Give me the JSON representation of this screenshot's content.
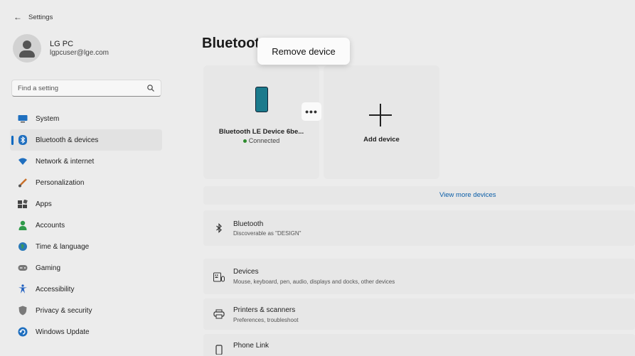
{
  "window": {
    "title": "Settings",
    "back_icon": "back-arrow-icon"
  },
  "profile": {
    "name": "LG PC",
    "email": "lgpcuser@lge.com"
  },
  "search": {
    "placeholder": "Find a setting"
  },
  "sidebar": {
    "items": [
      {
        "label": "System",
        "icon": "system-icon"
      },
      {
        "label": "Bluetooth & devices",
        "icon": "bluetooth-icon",
        "active": true
      },
      {
        "label": "Network & internet",
        "icon": "wifi-icon"
      },
      {
        "label": "Personalization",
        "icon": "brush-icon"
      },
      {
        "label": "Apps",
        "icon": "apps-icon"
      },
      {
        "label": "Accounts",
        "icon": "person-icon"
      },
      {
        "label": "Time & language",
        "icon": "globe-icon"
      },
      {
        "label": "Gaming",
        "icon": "gamepad-icon"
      },
      {
        "label": "Accessibility",
        "icon": "accessibility-icon"
      },
      {
        "label": "Privacy & security",
        "icon": "shield-icon"
      },
      {
        "label": "Windows Update",
        "icon": "update-icon"
      }
    ]
  },
  "main": {
    "title": "Bluetoot",
    "tooltip": "Remove device",
    "more_button": "•••",
    "device": {
      "name": "Bluetooth LE Device 6be...",
      "status": "Connected"
    },
    "add_device": "Add device",
    "view_more": "View more devices",
    "rows": [
      {
        "title": "Bluetooth",
        "subtitle": "Discoverable as \"DESIGN\""
      },
      {
        "title": "Devices",
        "subtitle": "Mouse, keyboard, pen, audio, displays and docks, other devices"
      },
      {
        "title": "Printers & scanners",
        "subtitle": "Preferences, troubleshoot"
      },
      {
        "title": "Phone Link",
        "subtitle": ""
      }
    ]
  },
  "colors": {
    "accent": "#0067c0",
    "link": "#0a5ea8",
    "connected": "#2e8b2e",
    "background": "#ececec",
    "card": "#e7e7e7"
  }
}
